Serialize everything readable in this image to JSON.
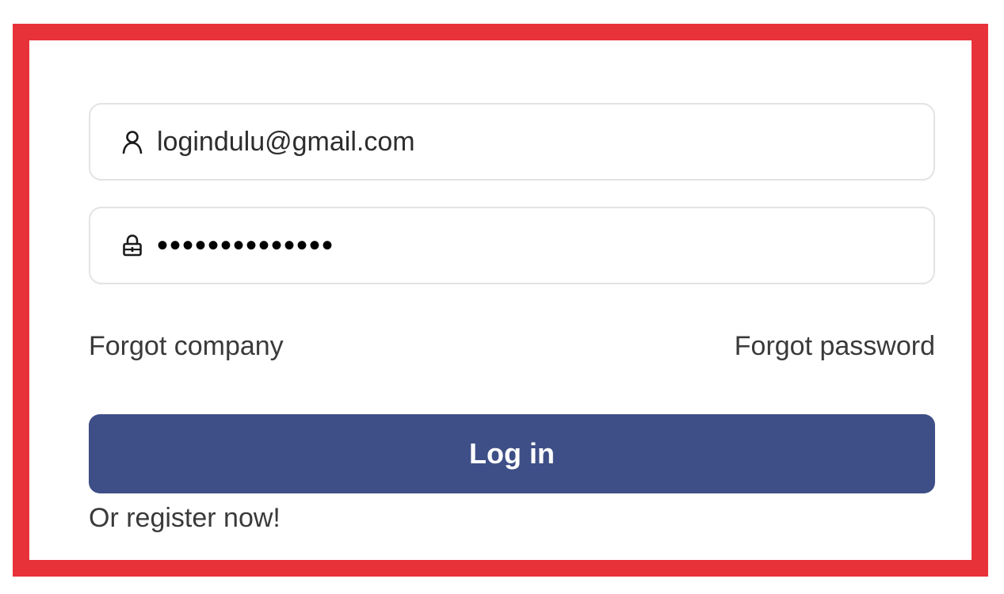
{
  "login_form": {
    "email": {
      "value": "logindulu@gmail.com",
      "icon": "user-icon"
    },
    "password": {
      "value": "••••••••••••••",
      "icon": "lock-icon"
    },
    "forgot_company_label": "Forgot company",
    "forgot_password_label": "Forgot password",
    "login_button_label": "Log in",
    "register_label": "Or register now!"
  },
  "colors": {
    "frame_border": "#e8323a",
    "button_background": "#3e4f87",
    "button_text": "#ffffff",
    "field_border": "#e3e3e3"
  }
}
